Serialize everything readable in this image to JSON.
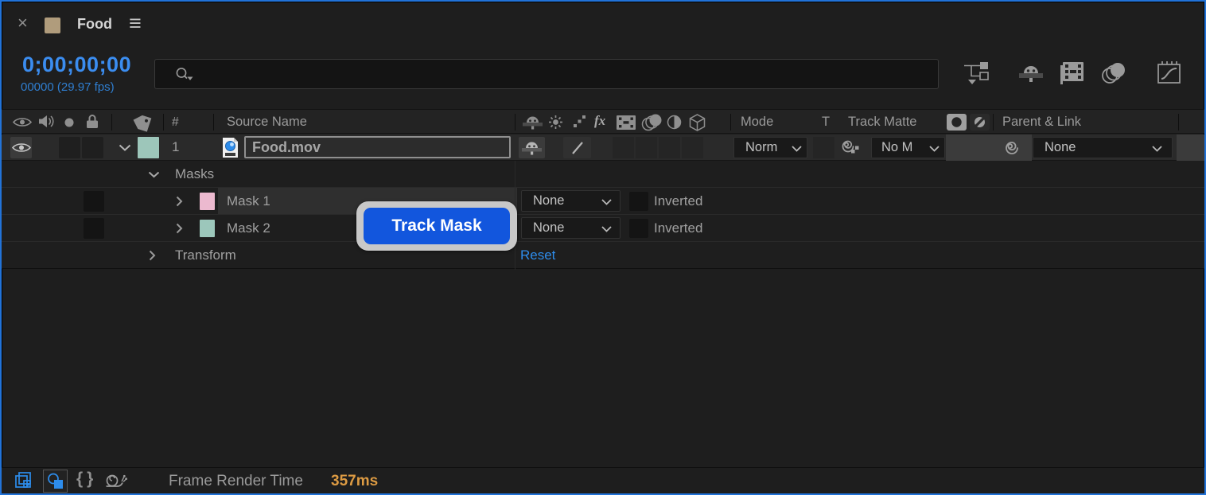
{
  "tab": {
    "title": "Food"
  },
  "toolbar": {
    "timecode": "0;00;00;00",
    "frame_info": "00000 (29.97 fps)"
  },
  "search": {
    "value": ""
  },
  "columns": {
    "number": "#",
    "source_name": "Source Name",
    "mode": "Mode",
    "t": "T",
    "track_matte": "Track Matte",
    "parent_link": "Parent & Link"
  },
  "layer": {
    "number": "1",
    "name": "Food.mov",
    "mode": "Norm",
    "track_matte": "No M",
    "parent": "None"
  },
  "masks": {
    "group_label": "Masks",
    "items": [
      {
        "name": "Mask 1",
        "mode": "None",
        "inverted_label": "Inverted",
        "swatch": "#ecb9cf"
      },
      {
        "name": "Mask 2",
        "mode": "None",
        "inverted_label": "Inverted",
        "swatch": "#9cc7bb"
      }
    ]
  },
  "transform": {
    "label": "Transform",
    "reset_label": "Reset"
  },
  "overlay": {
    "button_label": "Track Mask"
  },
  "status_bar": {
    "label": "Frame Render Time",
    "value": "357ms"
  },
  "icons": {
    "close": "×",
    "menu": "≡",
    "fx": "fx",
    "braces": "{}"
  },
  "colors": {
    "focus_border": "#2273d8",
    "accent_blue": "#2f8ceb",
    "timecode_blue": "#3b8df0",
    "button_blue": "#1256dd",
    "button_halo": "#c8c8c8",
    "render_time_orange": "#dd9b43",
    "tab_swatch": "#b09c7c",
    "layer_swatch": "#9dc6ba",
    "mask1_swatch": "#ecb9cf",
    "mask2_swatch": "#9cc7bb",
    "selection_highlight": "#2f2f2f"
  }
}
